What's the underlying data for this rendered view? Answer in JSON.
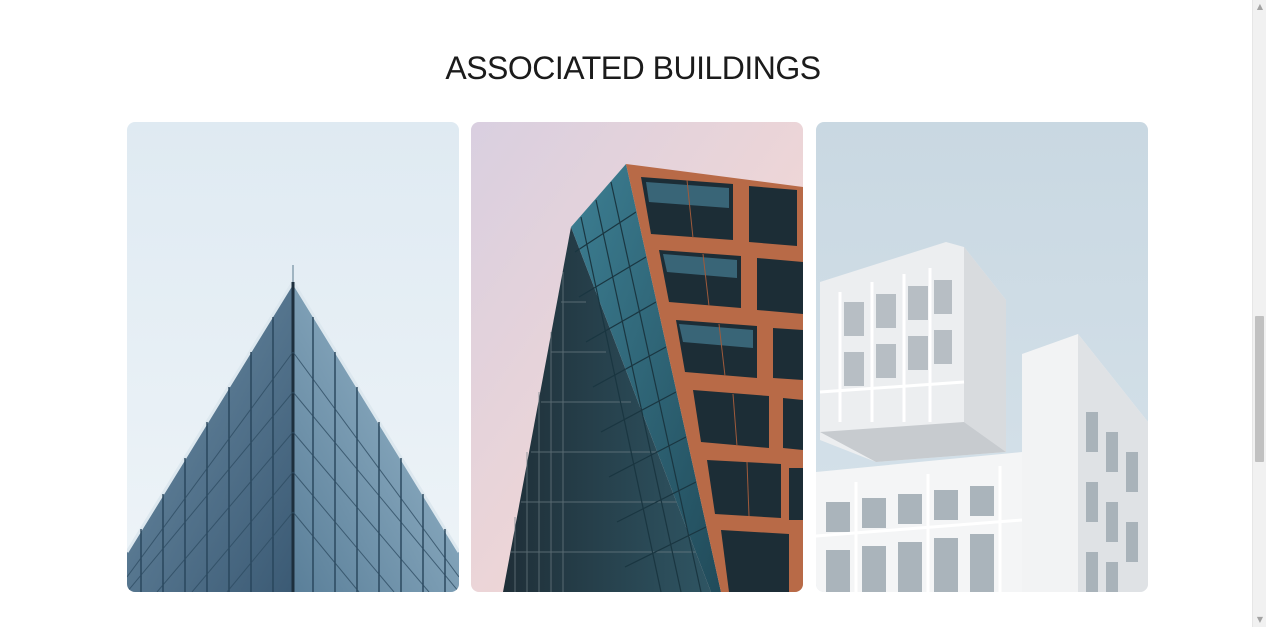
{
  "section": {
    "title": "ASSOCIATED BUILDINGS"
  },
  "gallery": {
    "images": [
      {
        "subject": "glass pyramid skyscraper corner"
      },
      {
        "subject": "glass tower with copper grid facade"
      },
      {
        "subject": "white modern apartment building"
      }
    ]
  },
  "scrollbar": {
    "up_icon": "triangle-up",
    "down_icon": "triangle-down",
    "up_glyph": "▲",
    "down_glyph": "▼"
  }
}
